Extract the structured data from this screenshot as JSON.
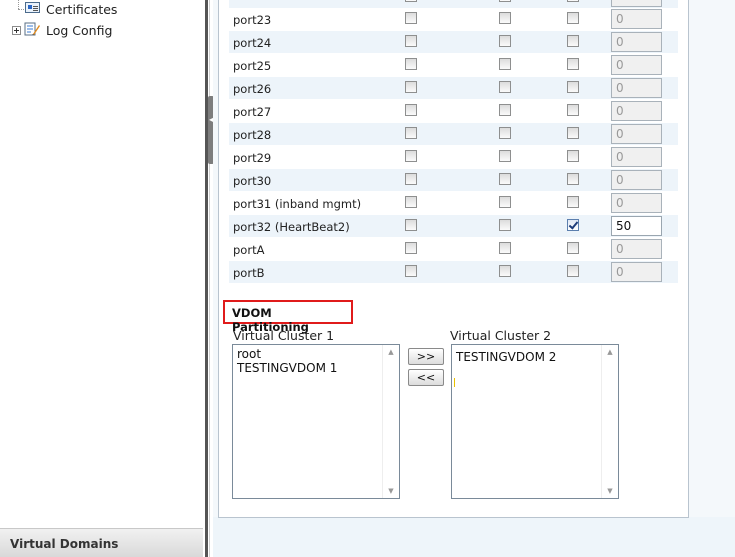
{
  "nav": {
    "items": [
      {
        "label": "Certificates",
        "icon": "certificate-icon"
      },
      {
        "label": "Log Config",
        "icon": "log-config-icon"
      }
    ],
    "footer": "Virtual Domains"
  },
  "ports": {
    "rows": [
      {
        "name": "port23",
        "c1": false,
        "c2": false,
        "c3": false,
        "priority": "0",
        "priority_enabled": false
      },
      {
        "name": "port24",
        "c1": false,
        "c2": false,
        "c3": false,
        "priority": "0",
        "priority_enabled": false
      },
      {
        "name": "port25",
        "c1": false,
        "c2": false,
        "c3": false,
        "priority": "0",
        "priority_enabled": false
      },
      {
        "name": "port26",
        "c1": false,
        "c2": false,
        "c3": false,
        "priority": "0",
        "priority_enabled": false
      },
      {
        "name": "port27",
        "c1": false,
        "c2": false,
        "c3": false,
        "priority": "0",
        "priority_enabled": false
      },
      {
        "name": "port28",
        "c1": false,
        "c2": false,
        "c3": false,
        "priority": "0",
        "priority_enabled": false
      },
      {
        "name": "port29",
        "c1": false,
        "c2": false,
        "c3": false,
        "priority": "0",
        "priority_enabled": false
      },
      {
        "name": "port30",
        "c1": false,
        "c2": false,
        "c3": false,
        "priority": "0",
        "priority_enabled": false
      },
      {
        "name": "port31 (inband mgmt)",
        "c1": false,
        "c2": false,
        "c3": false,
        "priority": "0",
        "priority_enabled": false
      },
      {
        "name": "port32 (HeartBeat2)",
        "c1": false,
        "c2": false,
        "c3": true,
        "priority": "50",
        "priority_enabled": true
      },
      {
        "name": "portA",
        "c1": false,
        "c2": false,
        "c3": false,
        "priority": "0",
        "priority_enabled": false
      },
      {
        "name": "portB",
        "c1": false,
        "c2": false,
        "c3": false,
        "priority": "0",
        "priority_enabled": false
      }
    ]
  },
  "vdom": {
    "title": "VDOM Partitioning",
    "cluster1": {
      "label": "Virtual Cluster 1",
      "options": [
        "root",
        "TESTINGVDOM 1"
      ]
    },
    "cluster2": {
      "label": "Virtual Cluster 2",
      "options": [
        "TESTINGVDOM 2"
      ]
    },
    "move_right_label": ">>",
    "move_left_label": "<<"
  },
  "colors": {
    "highlight_border": "#e01b1b",
    "row_alt": "#edf4fa"
  }
}
